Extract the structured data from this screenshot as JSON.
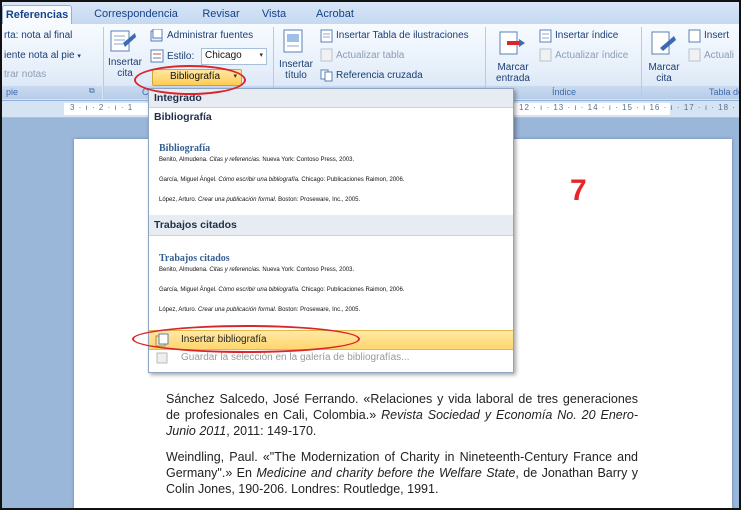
{
  "tabs": [
    "Referencias",
    "Correspondencia",
    "Revisar",
    "Vista",
    "Acrobat"
  ],
  "active_tab": "Referencias",
  "ribbon": {
    "footnotes": {
      "line1": "rta: nota al final",
      "line2": "iente nota al pie",
      "line2_arrow": "▾",
      "line3": "trar notas",
      "group_label": "pie",
      "launcher": "⧉"
    },
    "citations": {
      "insert_citation_label_1": "Insertar",
      "insert_citation_label_2": "cita",
      "manage_sources": "Administrar fuentes",
      "style_label": "Estilo:",
      "style_value": "Chicago",
      "bibliography_button": "Bibliografía",
      "bibliography_arrow": "▾",
      "group_label": "C"
    },
    "captions": {
      "insert_caption_1": "Insertar",
      "insert_caption_2": "título",
      "insert_table_figures": "Insertar Tabla de ilustraciones",
      "update_table": "Actualizar tabla",
      "cross_reference": "Referencia cruzada"
    },
    "index": {
      "mark_entry_1": "Marcar",
      "mark_entry_2": "entrada",
      "insert_index": "Insertar índice",
      "update_index": "Actualizar índice",
      "group_label": "Índice"
    },
    "toa": {
      "mark_citation_1": "Marcar",
      "mark_citation_2": "cita",
      "insert": "Insert",
      "update": "Actuali",
      "group_label": "Tabla de"
    }
  },
  "ruler": {
    "left": "3 · ı · 2 · ı · 1",
    "right": "12 · ı · 13 · ı · 14 · ı · 15 · ı 16 · ı · 17 · ı · 18 ·"
  },
  "dropdown": {
    "section_builtin": "Integrado",
    "item1": {
      "name": "Bibliografía",
      "preview_title": "Bibliografía",
      "entries": [
        {
          "author": "Benito, Almudena. ",
          "title": "Citas y referencias.",
          "rest": " Nueva York: Contoso Press, 2003."
        },
        {
          "author": "García, Miguel Ángel. ",
          "title": "Cómo escribir una bibliografía.",
          "rest": " Chicago: Publicaciones Raimon, 2006."
        },
        {
          "author": "López, Arturo. ",
          "title": "Crear una publicación formal.",
          "rest": " Boston: Proseware, Inc., 2005."
        }
      ]
    },
    "item2": {
      "name": "Trabajos citados",
      "preview_title": "Trabajos citados",
      "entries": [
        {
          "author": "Benito, Almudena. ",
          "title": "Citas y referencias.",
          "rest": " Nueva York: Contoso Press, 2003."
        },
        {
          "author": "García, Miguel Ángel. ",
          "title": "Cómo escribir una bibliografía.",
          "rest": " Chicago: Publicaciones Raimon, 2006."
        },
        {
          "author": "López, Arturo. ",
          "title": "Crear una publicación formal.",
          "rest": " Boston: Proseware, Inc., 2005."
        }
      ]
    },
    "insert_bibliography": "Insertar bibliografía",
    "save_selection": "Guardar la selección en la galería de bibliografías..."
  },
  "annotation_number": "7",
  "document": {
    "ref1_a": "Sánchez Salcedo, José Ferrando. «Relaciones y vida laboral de tres generaciones de profesionales en Cali, Colombia.» ",
    "ref1_italic": "Revista Sociedad y Economía No. 20 Enero-Junio 2011",
    "ref1_b": ", 2011: 149-170.",
    "ref2_a": "Weindling, Paul. «\"The Modernization of Charity in Nineteenth-Century France and Germany\".» En ",
    "ref2_italic": "Medicine and charity before the Welfare State",
    "ref2_b": ", de Jonathan Barry y Colin Jones, 190-206. Londres: Routledge, 1991."
  },
  "colors": {
    "accent_red": "#d9262b",
    "hover_yellow": "#ffd66e",
    "ribbon_blue": "#c5d9f1",
    "annotation": "#e8262a"
  }
}
